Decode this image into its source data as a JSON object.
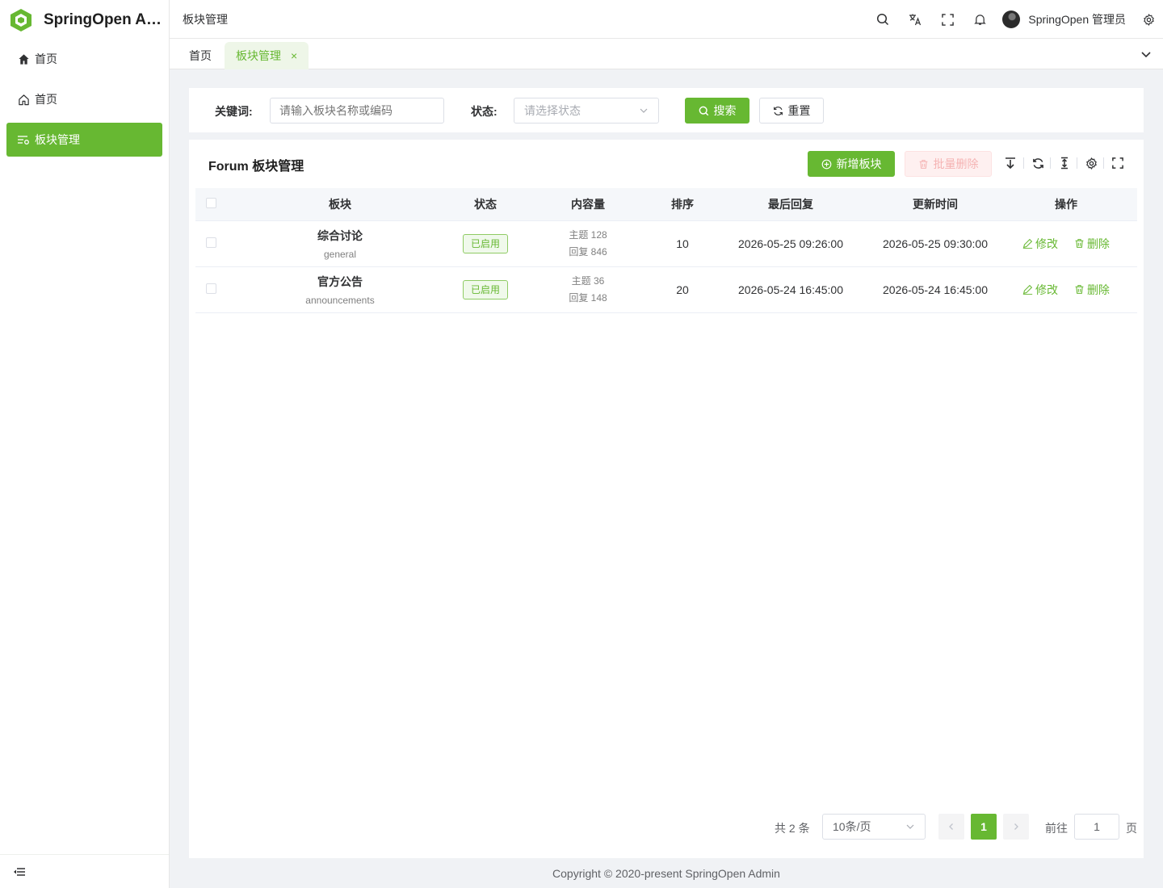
{
  "app": {
    "title": "SpringOpen Ad...",
    "accent": "#67b832"
  },
  "sidebar": {
    "items": [
      {
        "label": "首页",
        "icon": "home-filled-icon"
      },
      {
        "label": "首页",
        "icon": "home-outline-icon"
      },
      {
        "label": "板块管理",
        "icon": "list-settings-icon",
        "active": true
      }
    ]
  },
  "header": {
    "breadcrumb": "板块管理",
    "user_name": "SpringOpen 管理员"
  },
  "tabs": [
    {
      "label": "首页"
    },
    {
      "label": "板块管理",
      "active": true,
      "close": "×"
    }
  ],
  "filter": {
    "keyword_label": "关键词:",
    "keyword_placeholder": "请输入板块名称或编码",
    "status_label": "状态:",
    "status_placeholder": "请选择状态",
    "search_label": "搜索",
    "reset_label": "重置"
  },
  "panel": {
    "title": "Forum 板块管理",
    "add_label": "新增板块",
    "batch_delete_label": "批量删除"
  },
  "table": {
    "columns": [
      "板块",
      "状态",
      "内容量",
      "排序",
      "最后回复",
      "更新时间",
      "操作"
    ],
    "rows": [
      {
        "name": "综合讨论",
        "code": "general",
        "status": "已启用",
        "topics": "主题 128",
        "replies": "回复 846",
        "sort": "10",
        "last_reply": "2026-05-25 09:26:00",
        "updated": "2026-05-25 09:30:00"
      },
      {
        "name": "官方公告",
        "code": "announcements",
        "status": "已启用",
        "topics": "主题 36",
        "replies": "回复 148",
        "sort": "20",
        "last_reply": "2026-05-24 16:45:00",
        "updated": "2026-05-24 16:45:00"
      }
    ],
    "edit_label": "修改",
    "delete_label": "删除"
  },
  "pagination": {
    "total": "共 2 条",
    "page_size": "10条/页",
    "current": "1",
    "goto_label": "前往",
    "goto_value": "1",
    "page_suffix": "页"
  },
  "footer": {
    "copyright": "Copyright © 2020-present SpringOpen Admin"
  }
}
